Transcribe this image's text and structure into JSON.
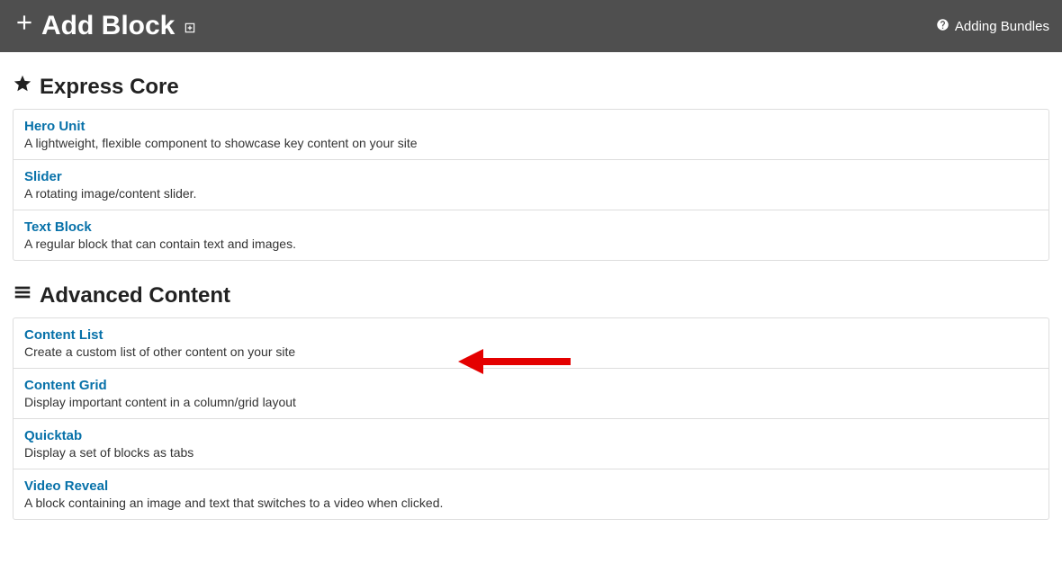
{
  "header": {
    "title": "Add Block",
    "help_link": "Adding Bundles"
  },
  "sections": [
    {
      "heading": "Express Core",
      "icon": "star",
      "items": [
        {
          "title": "Hero Unit",
          "desc": "A lightweight, flexible component to showcase key content on your site"
        },
        {
          "title": "Slider",
          "desc": "A rotating image/content slider."
        },
        {
          "title": "Text Block",
          "desc": "A regular block that can contain text and images."
        }
      ]
    },
    {
      "heading": "Advanced Content",
      "icon": "list",
      "items": [
        {
          "title": "Content List",
          "desc": "Create a custom list of other content on your site"
        },
        {
          "title": "Content Grid",
          "desc": "Display important content in a column/grid layout"
        },
        {
          "title": "Quicktab",
          "desc": "Display a set of blocks as tabs"
        },
        {
          "title": "Video Reveal",
          "desc": "A block containing an image and text that switches to a video when clicked."
        }
      ]
    }
  ]
}
